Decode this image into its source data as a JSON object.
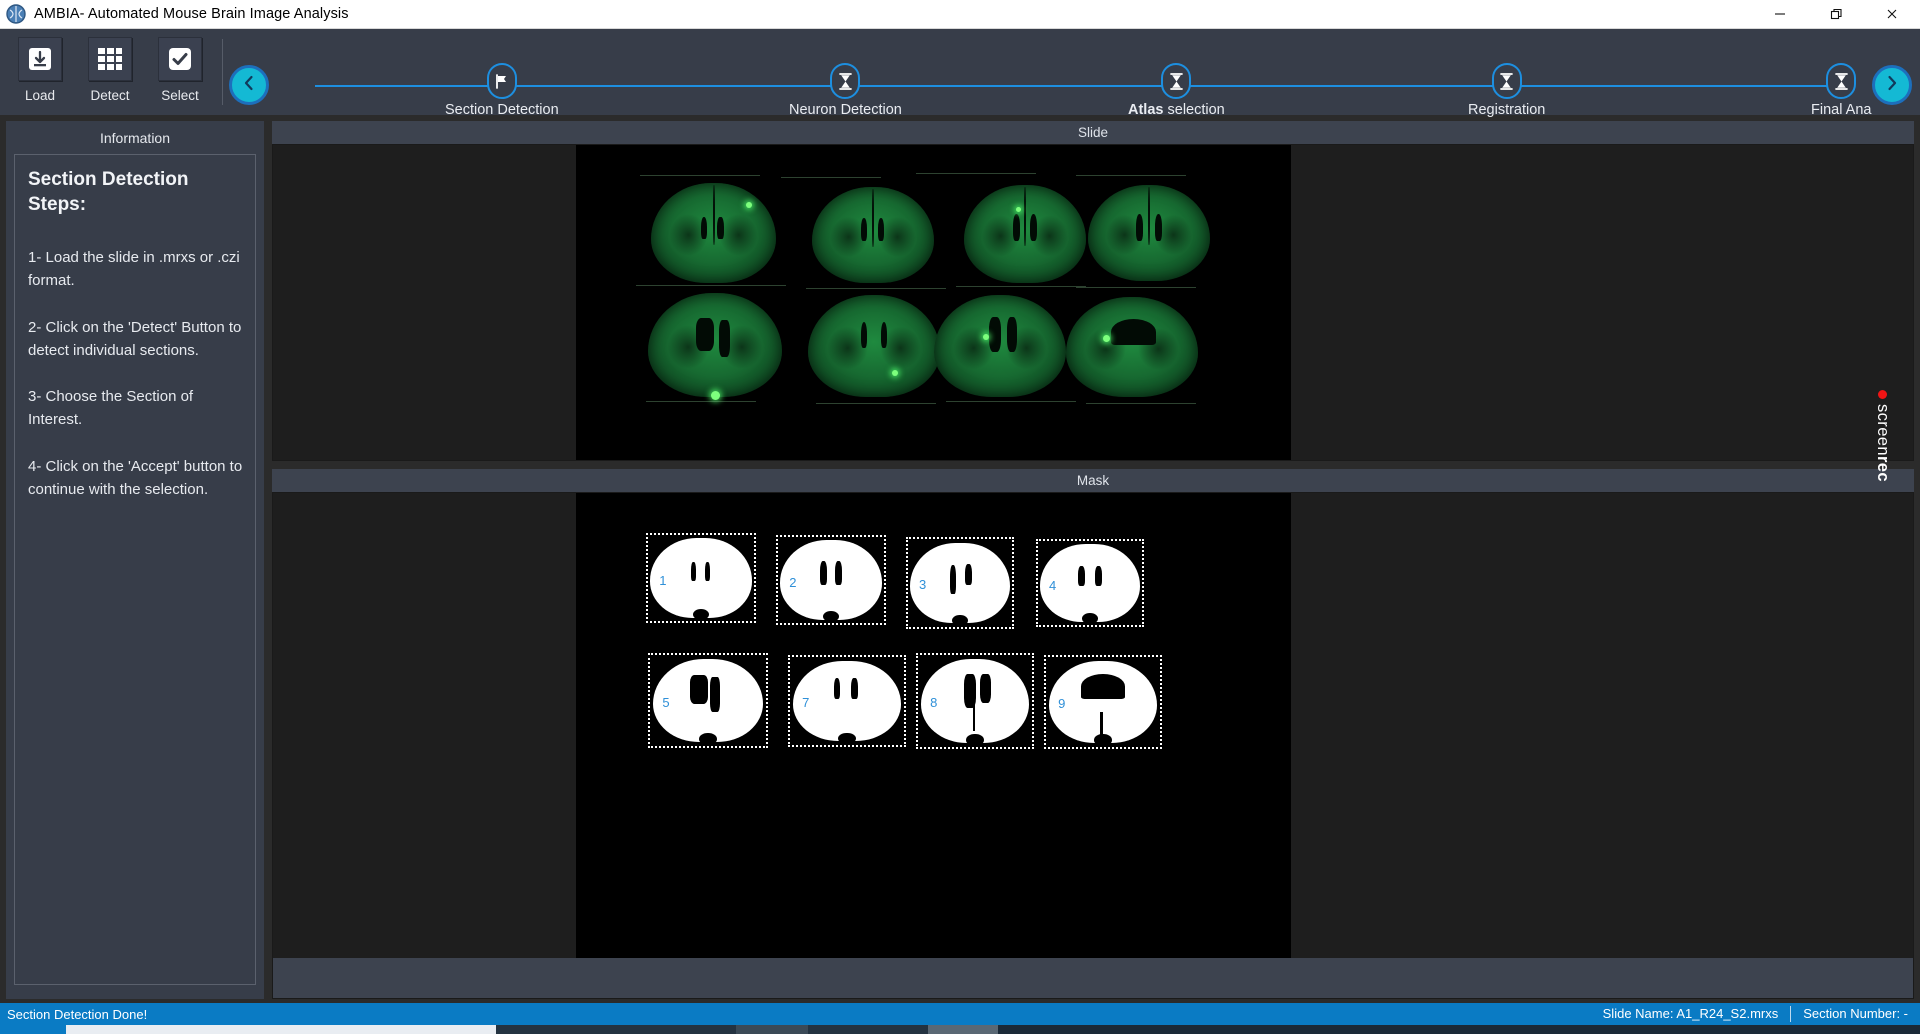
{
  "window": {
    "title": "AMBIA- Automated Mouse Brain Image Analysis",
    "logo_icon": "brain-icon",
    "minimize_icon": "minimize-icon",
    "restore_icon": "restore-icon",
    "close_icon": "close-icon"
  },
  "toolbar": {
    "buttons": [
      {
        "label": "Load",
        "icon": "download-icon"
      },
      {
        "label": "Detect",
        "icon": "grid-icon"
      },
      {
        "label": "Select",
        "icon": "check-icon"
      }
    ]
  },
  "stepper": {
    "prev_icon": "chevron-left-icon",
    "next_icon": "chevron-right-icon",
    "accent_color": "#1d8fe0",
    "nav_color": "#14b9d4",
    "steps": [
      {
        "label": "Section Detection",
        "icon": "flag-icon",
        "bold_prefix": ""
      },
      {
        "label": "Neuron Detection",
        "icon": "hourglass-icon",
        "bold_prefix": ""
      },
      {
        "label": "selection",
        "icon": "hourglass-icon",
        "bold_prefix": "Atlas"
      },
      {
        "label": "Registration",
        "icon": "hourglass-icon",
        "bold_prefix": ""
      },
      {
        "label": "Final Ana",
        "icon": "hourglass-icon",
        "bold_prefix": ""
      }
    ]
  },
  "information": {
    "header": "Information",
    "title": "Section Detection Steps:",
    "steps": [
      "1- Load the slide in .mrxs or .czi format.",
      "2- Click on the 'Detect' Button to detect individual sections.",
      "3- Choose the Section of Interest.",
      "4- Click on the 'Accept' button to continue with the selection."
    ]
  },
  "viewers": {
    "slide": {
      "title": "Slide"
    },
    "mask": {
      "title": "Mask",
      "sections": [
        {
          "number": "1"
        },
        {
          "number": "2"
        },
        {
          "number": "3"
        },
        {
          "number": "4"
        },
        {
          "number": "5"
        },
        {
          "number": "7"
        },
        {
          "number": "8"
        },
        {
          "number": "9"
        }
      ]
    }
  },
  "watermark": {
    "text_light": "screen",
    "text_bold": "rec",
    "dot_color": "#f01414"
  },
  "statusbar": {
    "message": "Section Detection Done!",
    "slide_name": "Slide Name: A1_R24_S2.mrxs",
    "section_number": "Section Number: -",
    "background": "#0a7bc4"
  }
}
